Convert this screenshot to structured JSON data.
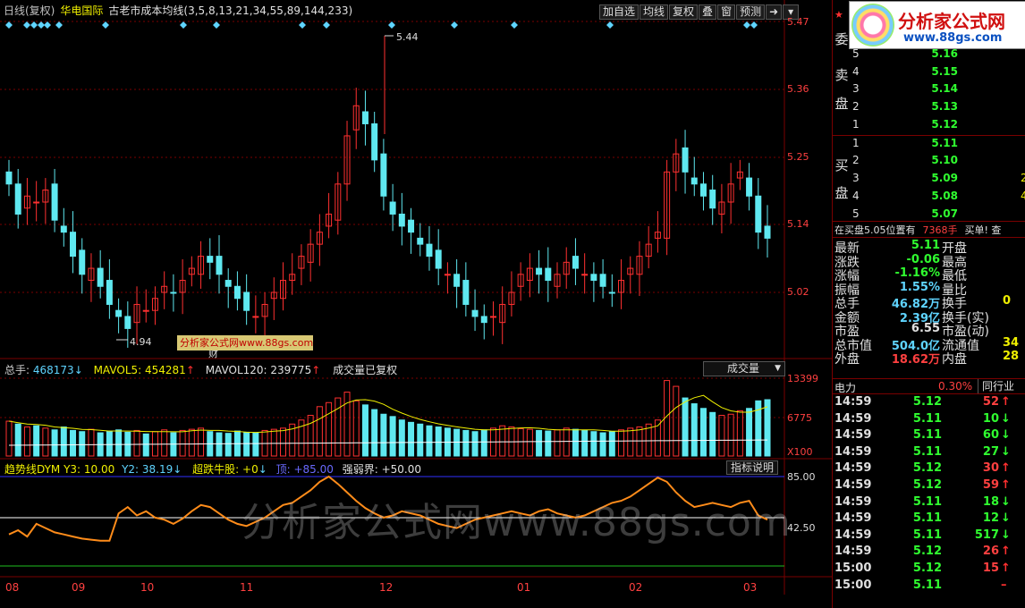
{
  "title_bar": {
    "period": "日线(复权)",
    "stock": "华电国际",
    "indicator": "古老市成本均线(3,5,8,13,21,34,55,89,144,233)"
  },
  "toolbar": [
    "加自选",
    "均线",
    "复权",
    "叠",
    "窗",
    "预测"
  ],
  "toolbar_icons": [
    "arrow-right-icon",
    "chevron-down-icon"
  ],
  "price_axis": [
    "5.47",
    "5.36",
    "5.25",
    "5.14",
    "5.02"
  ],
  "price_notes": {
    "high": "5.44",
    "low": "4.94",
    "cai": "财"
  },
  "volume_panel": {
    "label": "总手:",
    "total": "468173",
    "mavol5": "MAVOL5: 454281",
    "mavol120": "MAVOL120: 239775",
    "note": "成交量已复权",
    "select": "成交量",
    "axis": [
      "13399",
      "6775",
      "X100"
    ]
  },
  "indicator_panel": {
    "name": "趋势线DYM Y3: 10.00",
    "y2": "Y2: 38.19",
    "signal": "超跌牛股: +0",
    "top": "顶: +85.00",
    "strong": "强弱界: +50.00",
    "help": "指标说明",
    "axis": [
      "85.00",
      "42.50"
    ]
  },
  "x_axis": [
    "08",
    "09",
    "10",
    "11",
    "12",
    "01",
    "02",
    "03"
  ],
  "watermark_small": "分析家公式网www.88gs.com",
  "watermark_big": "分析家公式网www.88gs.com",
  "logo": {
    "text": "分析家公式网",
    "url": "www.88gs.com"
  },
  "order_book": {
    "ask_label": [
      "委",
      "卖",
      "盘"
    ],
    "bid_label": [
      "买",
      "盘"
    ],
    "asks": [
      {
        "level": "5",
        "price": "5.16"
      },
      {
        "level": "4",
        "price": "5.15"
      },
      {
        "level": "3",
        "price": "5.14"
      },
      {
        "level": "2",
        "price": "5.13"
      },
      {
        "level": "1",
        "price": "5.12"
      }
    ],
    "bids": [
      {
        "level": "1",
        "price": "5.11"
      },
      {
        "level": "2",
        "price": "5.10"
      },
      {
        "level": "3",
        "price": "5.09",
        "vol": "2"
      },
      {
        "level": "4",
        "price": "5.08",
        "vol": "4"
      },
      {
        "level": "5",
        "price": "5.07"
      }
    ]
  },
  "order_info": {
    "a": "在买盘5.05位置有",
    "b": "7368手",
    "c": "买单! 查"
  },
  "stats": [
    {
      "k1": "最新",
      "v1": "5.11",
      "c1": "#30ff30",
      "k2": "开盘",
      "v2": ""
    },
    {
      "k1": "涨跌",
      "v1": "-0.06",
      "c1": "#30ff30",
      "k2": "最高",
      "v2": ""
    },
    {
      "k1": "涨幅",
      "v1": "-1.16%",
      "c1": "#30ff30",
      "k2": "最低",
      "v2": ""
    },
    {
      "k1": "振幅",
      "v1": "1.55%",
      "c1": "#5fd4ff",
      "k2": "量比",
      "v2": ""
    },
    {
      "k1": "总手",
      "v1": "46.82万",
      "c1": "#5fd4ff",
      "k2": "换手",
      "v2": "0"
    },
    {
      "k1": "金额",
      "v1": "2.39亿",
      "c1": "#5fd4ff",
      "k2": "换手(实)",
      "v2": ""
    },
    {
      "k1": "市盈",
      "v1": "6.55",
      "c1": "#e0e0e0",
      "k2": "市盈(动)",
      "v2": ""
    },
    {
      "k1": "总市值",
      "v1": "504.0亿",
      "c1": "#5fd4ff",
      "k2": "流通值",
      "v2": "34"
    },
    {
      "k1": "外盘",
      "v1": "18.62万",
      "c1": "#ff4040",
      "k2": "内盘",
      "v2": "28"
    }
  ],
  "power": {
    "label": "电力",
    "value": "0.30%",
    "tab": "同行业"
  },
  "ticks": [
    {
      "time": "14:59",
      "price": "5.12",
      "pc": "#30ff30",
      "vol": "52",
      "vc": "#ff4040",
      "dir": "up"
    },
    {
      "time": "14:59",
      "price": "5.11",
      "pc": "#30ff30",
      "vol": "10",
      "vc": "#30ff30",
      "dir": "down"
    },
    {
      "time": "14:59",
      "price": "5.11",
      "pc": "#30ff30",
      "vol": "60",
      "vc": "#30ff30",
      "dir": "down"
    },
    {
      "time": "14:59",
      "price": "5.11",
      "pc": "#30ff30",
      "vol": "27",
      "vc": "#30ff30",
      "dir": "down"
    },
    {
      "time": "14:59",
      "price": "5.12",
      "pc": "#30ff30",
      "vol": "30",
      "vc": "#ff4040",
      "dir": "up"
    },
    {
      "time": "14:59",
      "price": "5.12",
      "pc": "#30ff30",
      "vol": "59",
      "vc": "#ff4040",
      "dir": "up"
    },
    {
      "time": "14:59",
      "price": "5.11",
      "pc": "#30ff30",
      "vol": "18",
      "vc": "#30ff30",
      "dir": "down"
    },
    {
      "time": "14:59",
      "price": "5.11",
      "pc": "#30ff30",
      "vol": "12",
      "vc": "#30ff30",
      "dir": "down"
    },
    {
      "time": "14:59",
      "price": "5.11",
      "pc": "#30ff30",
      "vol": "517",
      "vc": "#30ff30",
      "dir": "down"
    },
    {
      "time": "14:59",
      "price": "5.12",
      "pc": "#30ff30",
      "vol": "26",
      "vc": "#ff4040",
      "dir": "up"
    },
    {
      "time": "15:00",
      "price": "5.12",
      "pc": "#30ff30",
      "vol": "15",
      "vc": "#ff4040",
      "dir": "up"
    },
    {
      "time": "15:00",
      "price": "5.11",
      "pc": "#30ff30",
      "vol": "",
      "vc": "#ff4040",
      "dir": "none"
    }
  ],
  "colors": {
    "up": "#ff3030",
    "down": "#5fe8f0",
    "grid": "#7a0000",
    "ma_white": "#ffffff",
    "indicator_line": "#ff8c1a"
  },
  "chart_data": {
    "type": "candlestick",
    "period": "daily",
    "price_range": [
      4.9,
      5.5
    ],
    "high": 5.44,
    "low": 4.94,
    "closes": [
      5.2,
      5.15,
      5.18,
      5.17,
      5.19,
      5.14,
      5.12,
      5.08,
      5.05,
      5.06,
      5.03,
      5.0,
      4.98,
      4.96,
      5.0,
      4.99,
      5.01,
      5.03,
      5.02,
      5.04,
      5.06,
      5.08,
      5.07,
      5.05,
      5.03,
      5.01,
      4.99,
      4.98,
      5.0,
      5.02,
      5.04,
      5.05,
      5.08,
      5.1,
      5.12,
      5.15,
      5.2,
      5.28,
      5.33,
      5.3,
      5.24,
      5.18,
      5.15,
      5.13,
      5.12,
      5.1,
      5.08,
      5.06,
      5.05,
      5.03,
      5.0,
      4.98,
      4.97,
      4.98,
      5.0,
      5.02,
      5.05,
      5.06,
      5.05,
      5.04,
      5.05,
      5.07,
      5.06,
      5.05,
      5.04,
      5.03,
      5.02,
      5.04,
      5.06,
      5.08,
      5.1,
      5.12,
      5.22,
      5.25,
      5.22,
      5.2,
      5.18,
      5.16,
      5.17,
      5.2,
      5.22,
      5.18,
      5.12,
      5.11
    ],
    "volumes": [
      60,
      55,
      50,
      52,
      48,
      45,
      50,
      44,
      42,
      46,
      40,
      43,
      45,
      41,
      44,
      38,
      42,
      45,
      40,
      44,
      46,
      48,
      42,
      40,
      39,
      43,
      41,
      40,
      44,
      46,
      48,
      55,
      62,
      70,
      85,
      92,
      100,
      110,
      95,
      88,
      80,
      72,
      68,
      62,
      58,
      55,
      52,
      50,
      48,
      46,
      44,
      42,
      45,
      48,
      52,
      50,
      47,
      46,
      44,
      43,
      45,
      48,
      46,
      44,
      42,
      40,
      42,
      45,
      48,
      50,
      55,
      62,
      130,
      120,
      100,
      90,
      82,
      75,
      70,
      72,
      78,
      82,
      95,
      97
    ],
    "indicator": [
      30,
      34,
      28,
      40,
      36,
      32,
      30,
      28,
      26,
      25,
      24,
      24,
      50,
      56,
      48,
      52,
      46,
      44,
      40,
      45,
      52,
      58,
      56,
      50,
      44,
      40,
      38,
      42,
      46,
      52,
      58,
      60,
      66,
      72,
      80,
      85,
      78,
      70,
      62,
      55,
      50,
      46,
      48,
      52,
      50,
      48,
      44,
      40,
      38,
      36,
      40,
      44,
      46,
      48,
      50,
      52,
      50,
      48,
      52,
      54,
      50,
      48,
      46,
      48,
      52,
      56,
      60,
      62,
      66,
      72,
      78,
      84,
      80,
      70,
      62,
      56,
      58,
      60,
      58,
      56,
      60,
      62,
      48,
      44
    ],
    "strong_line": 50,
    "top_line": 85
  }
}
